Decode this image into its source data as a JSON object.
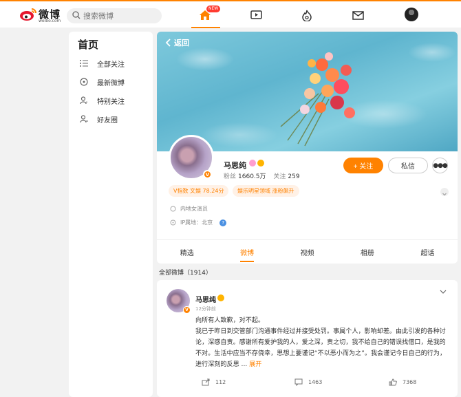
{
  "header": {
    "logo_text": "微博",
    "logo_url_text": "weibo.com",
    "search_placeholder": "搜索微博",
    "new_badge": "NEW"
  },
  "sidebar": {
    "title": "首页",
    "items": [
      {
        "label": "全部关注",
        "icon": "list-icon"
      },
      {
        "label": "最新微博",
        "icon": "clock-icon"
      },
      {
        "label": "特别关注",
        "icon": "user-star-icon"
      },
      {
        "label": "好友圈",
        "icon": "user-friends-icon"
      }
    ]
  },
  "profile": {
    "back_label": "返回",
    "name": "马思纯",
    "followers_label": "粉丝",
    "followers_value": "1660.5万",
    "following_label": "关注",
    "following_value": "259",
    "follow_button": "+ 关注",
    "message_button": "私信",
    "chips": [
      "V指数 文娱 78.24分",
      "娱乐明星领域 涨粉飙升"
    ],
    "bio": "内地女演员",
    "ip_label": "IP属地：北京",
    "tabs": [
      "精选",
      "微博",
      "视频",
      "相册",
      "超话"
    ],
    "active_tab": "微博",
    "colors": {
      "accent": "#ff8200",
      "chip_bg": "#fff1e6"
    }
  },
  "feed": {
    "count_label": "全部微博（1914）",
    "post": {
      "author": "马思纯",
      "time": "12分钟前",
      "line1": "向所有人致歉，对不起。",
      "text": "我已于昨日到交管部门沟通事件经过并接受处罚。事属个人，影响却差。由此引发的各种讨论，深感自责。感谢所有爱护我的人，爱之深，责之切，我不给自己的错误找借口，是我的不对。生活中应当不存侥幸，思想上要谨记“不以恶小而为之”。我会谨记今日自己的行为，进行深刻的反思 ...",
      "expand": "展开",
      "reposts": "112",
      "comments": "1463",
      "likes": "7368"
    }
  }
}
